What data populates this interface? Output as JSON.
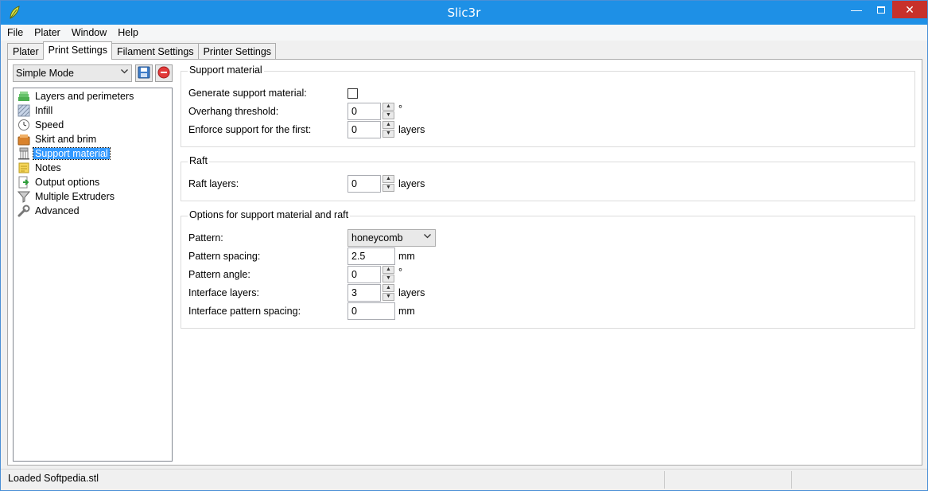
{
  "window": {
    "title": "Slic3r",
    "minimize_glyph": "—",
    "close_glyph": "✕"
  },
  "menu": [
    "File",
    "Plater",
    "Window",
    "Help"
  ],
  "tabs": [
    {
      "label": "Plater",
      "active": false
    },
    {
      "label": "Print Settings",
      "active": true
    },
    {
      "label": "Filament Settings",
      "active": false
    },
    {
      "label": "Printer Settings",
      "active": false
    }
  ],
  "sidebar": {
    "mode": "Simple Mode",
    "save_icon": "save-icon",
    "delete_icon": "delete-icon",
    "items": [
      {
        "label": "Layers and perimeters",
        "icon": "layers-icon",
        "selected": false
      },
      {
        "label": "Infill",
        "icon": "infill-icon",
        "selected": false
      },
      {
        "label": "Speed",
        "icon": "speed-icon",
        "selected": false
      },
      {
        "label": "Skirt and brim",
        "icon": "skirt-icon",
        "selected": false
      },
      {
        "label": "Support material",
        "icon": "support-icon",
        "selected": true
      },
      {
        "label": "Notes",
        "icon": "notes-icon",
        "selected": false
      },
      {
        "label": "Output options",
        "icon": "output-icon",
        "selected": false
      },
      {
        "label": "Multiple Extruders",
        "icon": "extruders-icon",
        "selected": false
      },
      {
        "label": "Advanced",
        "icon": "wrench-icon",
        "selected": false
      }
    ]
  },
  "support": {
    "title": "Support material",
    "generate_label": "Generate support material:",
    "generate_checked": false,
    "overhang_label": "Overhang threshold:",
    "overhang_value": "0",
    "overhang_unit": "°",
    "enforce_label": "Enforce support for the first:",
    "enforce_value": "0",
    "enforce_unit": "layers"
  },
  "raft": {
    "title": "Raft",
    "layers_label": "Raft layers:",
    "layers_value": "0",
    "layers_unit": "layers"
  },
  "options": {
    "title": "Options for support material and raft",
    "pattern_label": "Pattern:",
    "pattern_value": "honeycomb",
    "spacing_label": "Pattern spacing:",
    "spacing_value": "2.5",
    "spacing_unit": "mm",
    "angle_label": "Pattern angle:",
    "angle_value": "0",
    "angle_unit": "°",
    "interface_label": "Interface layers:",
    "interface_value": "3",
    "interface_unit": "layers",
    "interface_spacing_label": "Interface pattern spacing:",
    "interface_spacing_value": "0",
    "interface_spacing_unit": "mm"
  },
  "status": {
    "text": "Loaded Softpedia.stl"
  }
}
